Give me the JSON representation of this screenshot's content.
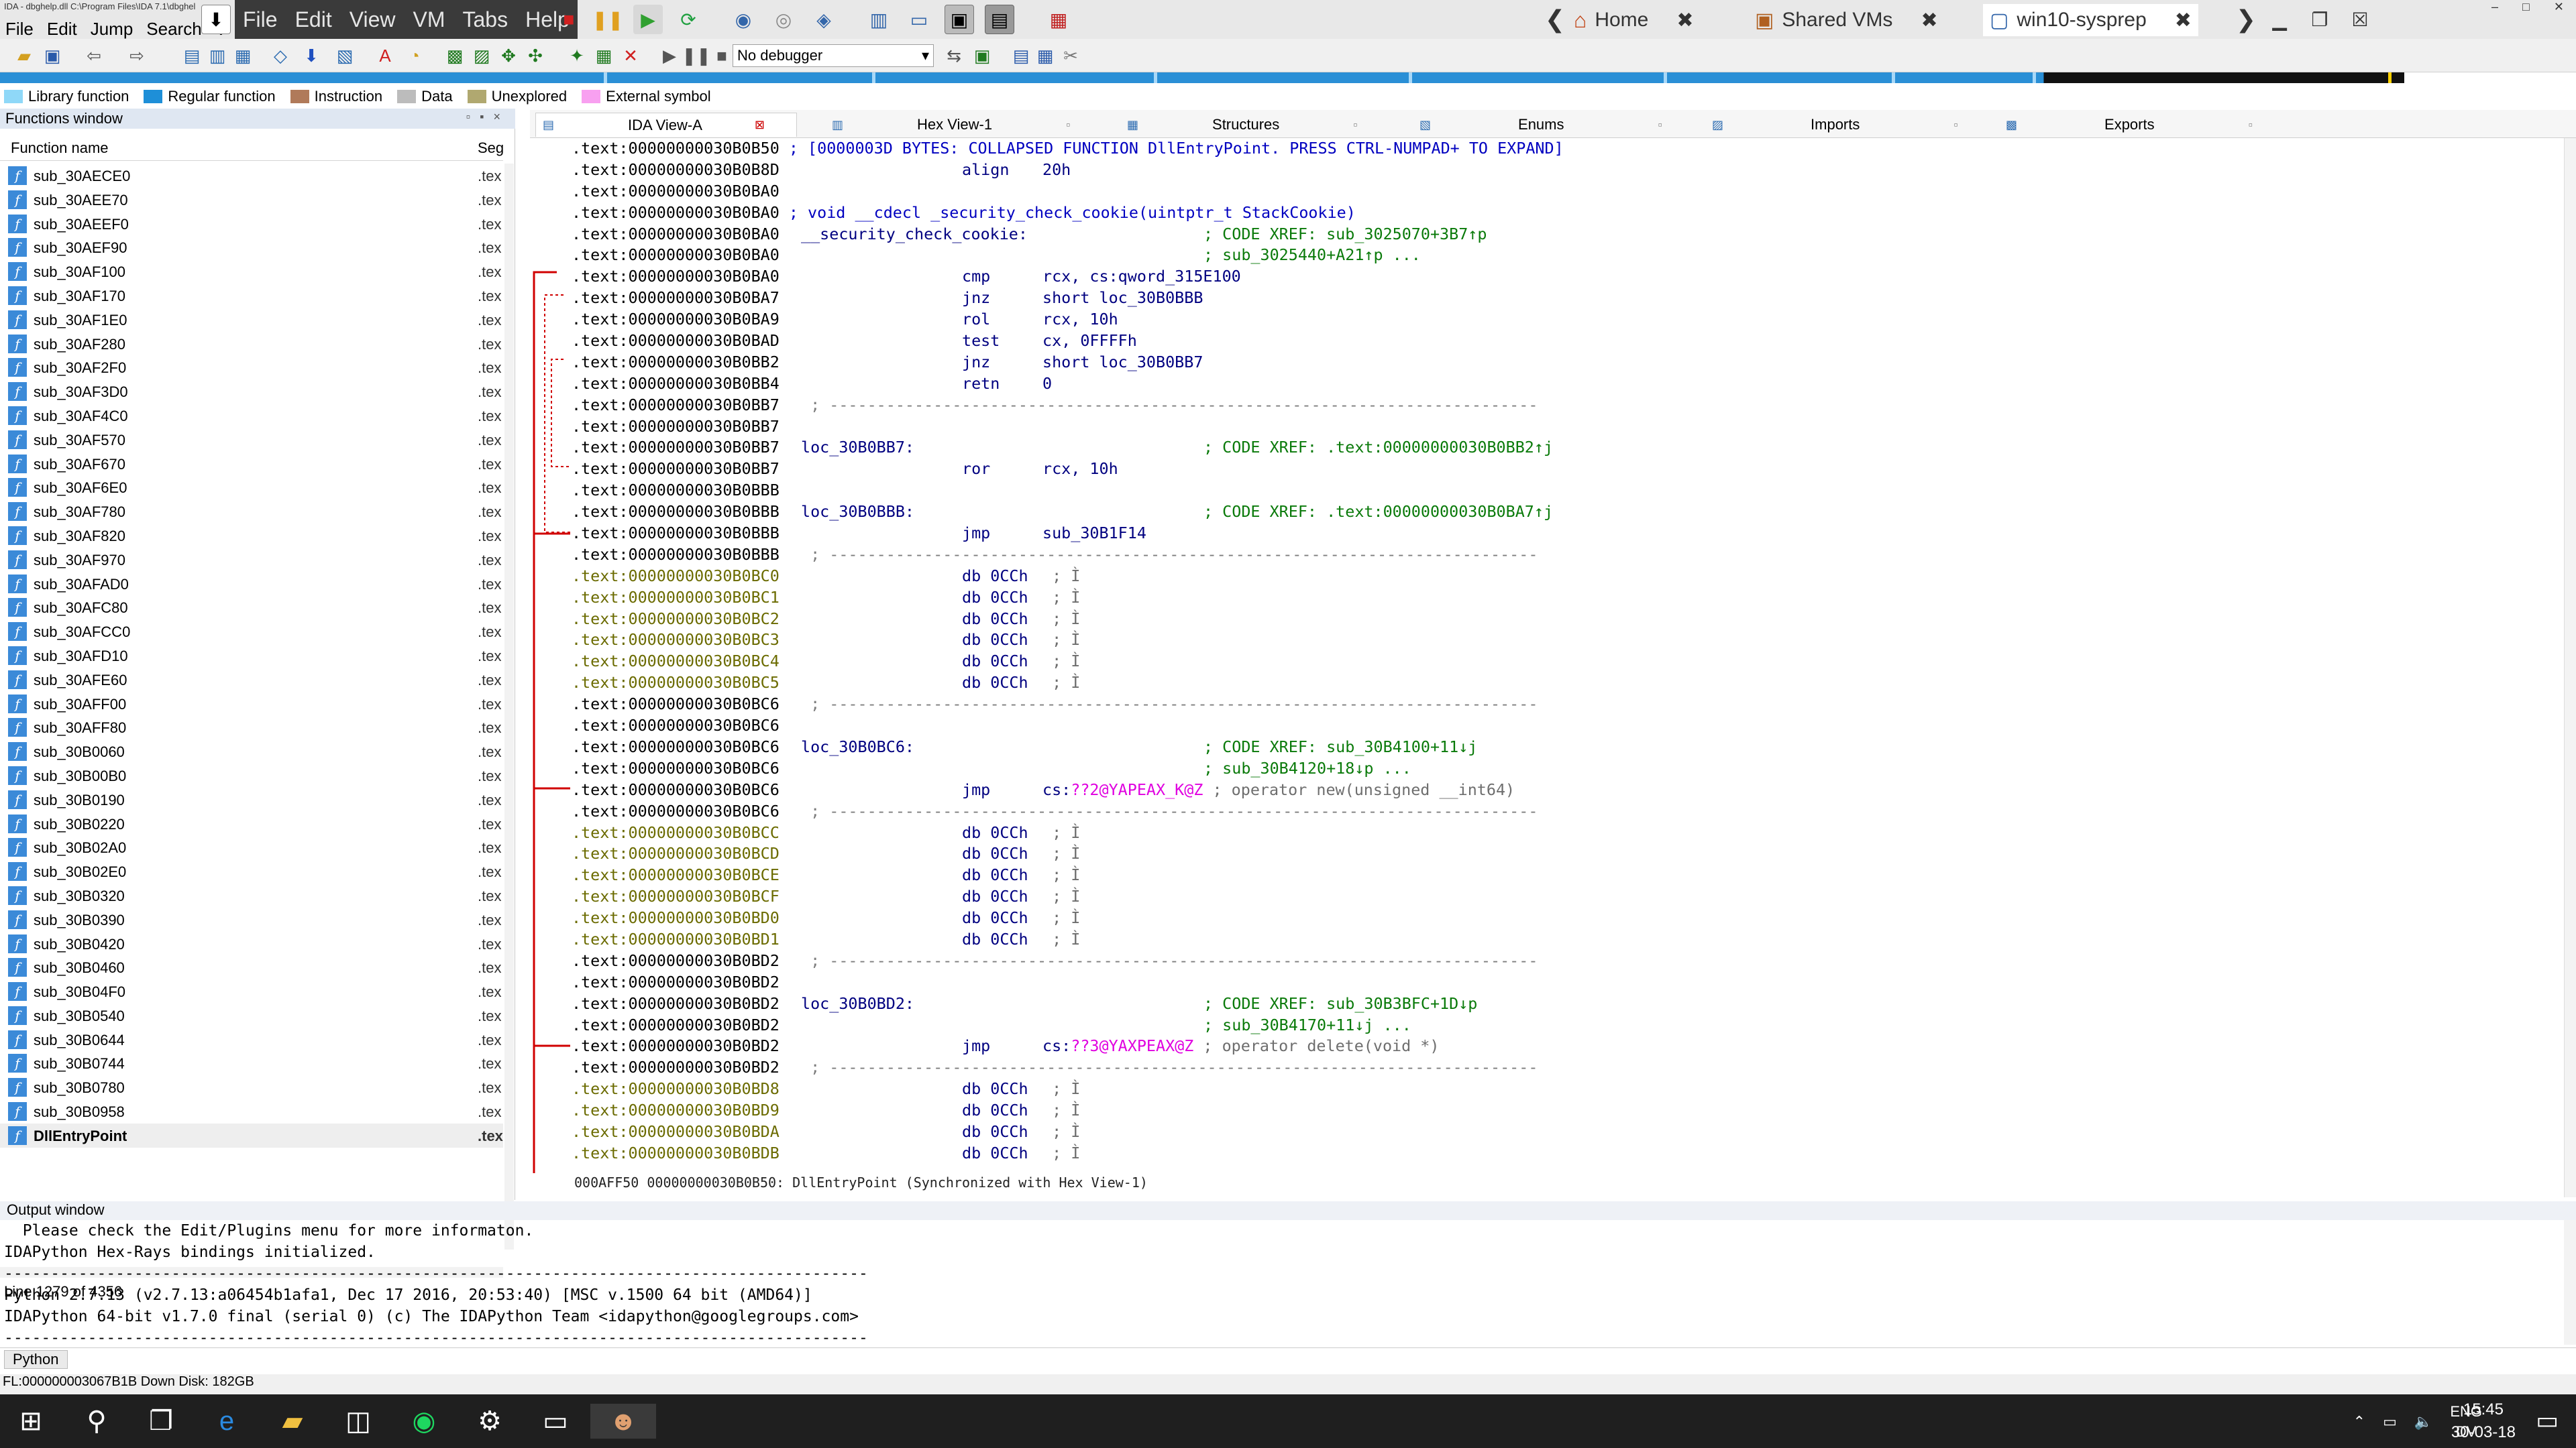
{
  "ida": {
    "title_text": "IDA - dbghelp.dll C:\\Program Files\\IDA 7.1\\dbghel",
    "menu": [
      "File",
      "Edit",
      "Jump",
      "Search",
      "V"
    ]
  },
  "vm": {
    "menu": [
      "File",
      "Edit",
      "View",
      "VM",
      "Tabs",
      "Help"
    ],
    "tabs": [
      {
        "label": "Home",
        "close": "✖"
      },
      {
        "label": "Shared VMs",
        "close": "✖"
      },
      {
        "label": "win10-sysprep",
        "close": "✖"
      }
    ]
  },
  "toolbar": {
    "debugger": "No debugger"
  },
  "legend": [
    {
      "label": "Library function",
      "color": "#8fd8f8"
    },
    {
      "label": "Regular function",
      "color": "#1e8fd8"
    },
    {
      "label": "Instruction",
      "color": "#b07a5a"
    },
    {
      "label": "Data",
      "color": "#bcbcbc"
    },
    {
      "label": "Unexplored",
      "color": "#b0a870"
    },
    {
      "label": "External symbol",
      "color": "#f8a0f0"
    }
  ],
  "functions_window": {
    "title": "Functions window",
    "col_name": "Function name",
    "col_seg": "Seg",
    "seg_value": ".tex",
    "functions": [
      "sub_30AECE0",
      "sub_30AEE70",
      "sub_30AEEF0",
      "sub_30AEF90",
      "sub_30AF100",
      "sub_30AF170",
      "sub_30AF1E0",
      "sub_30AF280",
      "sub_30AF2F0",
      "sub_30AF3D0",
      "sub_30AF4C0",
      "sub_30AF570",
      "sub_30AF670",
      "sub_30AF6E0",
      "sub_30AF780",
      "sub_30AF820",
      "sub_30AF970",
      "sub_30AFAD0",
      "sub_30AFC80",
      "sub_30AFCC0",
      "sub_30AFD10",
      "sub_30AFE60",
      "sub_30AFF00",
      "sub_30AFF80",
      "sub_30B0060",
      "sub_30B00B0",
      "sub_30B0190",
      "sub_30B0220",
      "sub_30B02A0",
      "sub_30B02E0",
      "sub_30B0320",
      "sub_30B0390",
      "sub_30B0420",
      "sub_30B0460",
      "sub_30B04F0",
      "sub_30B0540",
      "sub_30B0644",
      "sub_30B0744",
      "sub_30B0780",
      "sub_30B0958",
      "DllEntryPoint"
    ],
    "status": "Line 1279 of 4356"
  },
  "view_tabs": [
    "IDA View-A",
    "Hex View-1",
    "Structures",
    "Enums",
    "Imports",
    "Exports"
  ],
  "asm_status": "000AFF50 00000000030B0B50: DllEntryPoint (Synchronized with Hex View-1)",
  "asm": [
    {
      "addr": ".text:00000000030B0B50",
      "raw": " ; [0000003D BYTES: COLLAPSED FUNCTION DllEntryPoint. PRESS CTRL-NUMPAD+ TO EXPAND]",
      "kind": "collapsed"
    },
    {
      "addr": ".text:00000000030B0B8D",
      "mn": "align",
      "op": "20h",
      "kind": "gray"
    },
    {
      "addr": ".text:00000000030B0BA0"
    },
    {
      "addr": ".text:00000000030B0BA0",
      "raw": " ; void __cdecl _security_check_cookie(uintptr_t StackCookie)",
      "kind": "collapsed"
    },
    {
      "addr": ".text:00000000030B0BA0",
      "lbl": "__security_check_cookie:",
      "cm": "; CODE XREF: sub_3025070+3B7↑p"
    },
    {
      "addr": ".text:00000000030B0BA0",
      "cm": "; sub_3025440+A21↑p ..."
    },
    {
      "addr": ".text:00000000030B0BA0",
      "mn": "cmp",
      "op": "rcx, cs:qword_315E100"
    },
    {
      "addr": ".text:00000000030B0BA7",
      "mn": "jnz",
      "op": "short loc_30B0BBB"
    },
    {
      "addr": ".text:00000000030B0BA9",
      "mn": "rol",
      "op": "rcx, 10h"
    },
    {
      "addr": ".text:00000000030B0BAD",
      "mn": "test",
      "op": "cx, 0FFFFh"
    },
    {
      "addr": ".text:00000000030B0BB2",
      "mn": "jnz",
      "op": "short loc_30B0BB7"
    },
    {
      "addr": ".text:00000000030B0BB4",
      "mn": "retn",
      "op": "0"
    },
    {
      "addr": ".text:00000000030B0BB7",
      "sep": " ; ---------------------------------------------------------------------------"
    },
    {
      "addr": ".text:00000000030B0BB7"
    },
    {
      "addr": ".text:00000000030B0BB7",
      "lbl": "loc_30B0BB7:",
      "cm": "; CODE XREF: .text:00000000030B0BB2↑j"
    },
    {
      "addr": ".text:00000000030B0BB7",
      "mn": "ror",
      "op": "rcx, 10h"
    },
    {
      "addr": ".text:00000000030B0BBB"
    },
    {
      "addr": ".text:00000000030B0BBB",
      "lbl": "loc_30B0BBB:",
      "cm": "; CODE XREF: .text:00000000030B0BA7↑j"
    },
    {
      "addr": ".text:00000000030B0BBB",
      "mn": "jmp",
      "op": "sub_30B1F14"
    },
    {
      "addr": ".text:00000000030B0BBB",
      "sep": " ; ---------------------------------------------------------------------------"
    },
    {
      "addr": ".text:00000000030B0BC0",
      "mn": "db 0CCh",
      "op2": " ; Ì",
      "kind": "db"
    },
    {
      "addr": ".text:00000000030B0BC1",
      "mn": "db 0CCh",
      "op2": " ; Ì",
      "kind": "db"
    },
    {
      "addr": ".text:00000000030B0BC2",
      "mn": "db 0CCh",
      "op2": " ; Ì",
      "kind": "db"
    },
    {
      "addr": ".text:00000000030B0BC3",
      "mn": "db 0CCh",
      "op2": " ; Ì",
      "kind": "db"
    },
    {
      "addr": ".text:00000000030B0BC4",
      "mn": "db 0CCh",
      "op2": " ; Ì",
      "kind": "db"
    },
    {
      "addr": ".text:00000000030B0BC5",
      "mn": "db 0CCh",
      "op2": " ; Ì",
      "kind": "db"
    },
    {
      "addr": ".text:00000000030B0BC6",
      "sep": " ; ---------------------------------------------------------------------------"
    },
    {
      "addr": ".text:00000000030B0BC6"
    },
    {
      "addr": ".text:00000000030B0BC6",
      "lbl": "loc_30B0BC6:",
      "cm": "; CODE XREF: sub_30B4100+11↓j"
    },
    {
      "addr": ".text:00000000030B0BC6",
      "cm": "; sub_30B4120+18↓p ..."
    },
    {
      "addr": ".text:00000000030B0BC6",
      "mn": "jmp",
      "op": "cs:",
      "mg": "??2@YAPEAX_K@Z",
      "gc": " ; operator new(unsigned __int64)"
    },
    {
      "addr": ".text:00000000030B0BC6",
      "sep": " ; ---------------------------------------------------------------------------"
    },
    {
      "addr": ".text:00000000030B0BCC",
      "mn": "db 0CCh",
      "op2": " ; Ì",
      "kind": "db"
    },
    {
      "addr": ".text:00000000030B0BCD",
      "mn": "db 0CCh",
      "op2": " ; Ì",
      "kind": "db"
    },
    {
      "addr": ".text:00000000030B0BCE",
      "mn": "db 0CCh",
      "op2": " ; Ì",
      "kind": "db"
    },
    {
      "addr": ".text:00000000030B0BCF",
      "mn": "db 0CCh",
      "op2": " ; Ì",
      "kind": "db"
    },
    {
      "addr": ".text:00000000030B0BD0",
      "mn": "db 0CCh",
      "op2": " ; Ì",
      "kind": "db"
    },
    {
      "addr": ".text:00000000030B0BD1",
      "mn": "db 0CCh",
      "op2": " ; Ì",
      "kind": "db"
    },
    {
      "addr": ".text:00000000030B0BD2",
      "sep": " ; ---------------------------------------------------------------------------"
    },
    {
      "addr": ".text:00000000030B0BD2"
    },
    {
      "addr": ".text:00000000030B0BD2",
      "lbl": "loc_30B0BD2:",
      "cm": "; CODE XREF: sub_30B3BFC+1D↓p"
    },
    {
      "addr": ".text:00000000030B0BD2",
      "cm": "; sub_30B4170+11↓j ..."
    },
    {
      "addr": ".text:00000000030B0BD2",
      "mn": "jmp",
      "op": "cs:",
      "mg": "??3@YAXPEAX@Z",
      "gc": " ; operator delete(void *)"
    },
    {
      "addr": ".text:00000000030B0BD2",
      "sep": " ; ---------------------------------------------------------------------------"
    },
    {
      "addr": ".text:00000000030B0BD8",
      "mn": "db 0CCh",
      "op2": " ; Ì",
      "kind": "db"
    },
    {
      "addr": ".text:00000000030B0BD9",
      "mn": "db 0CCh",
      "op2": " ; Ì",
      "kind": "db"
    },
    {
      "addr": ".text:00000000030B0BDA",
      "mn": "db 0CCh",
      "op2": " ; Ì",
      "kind": "db"
    },
    {
      "addr": ".text:00000000030B0BDB",
      "mn": "db 0CCh",
      "op2": " ; Ì",
      "kind": "db"
    }
  ],
  "output": {
    "title": "Output window",
    "lines": [
      "  Please check the Edit/Plugins menu for more informaton.",
      "IDAPython Hex-Rays bindings initialized.",
      "---------------------------------------------------------------------------------------------",
      "Python 2.7.13 (v2.7.13:a06454b1afa1, Dec 17 2016, 20:53:40) [MSC v.1500 64 bit (AMD64)]",
      "IDAPython 64-bit v1.7.0 final (serial 0) (c) The IDAPython Team <idapython@googlegroups.com>",
      "---------------------------------------------------------------------------------------------"
    ],
    "python_tab": "Python"
  },
  "ida_status": "FL:000000003067B1B Down   Disk: 182GB",
  "taskbar": {
    "lang": "ENG",
    "layout": "DV",
    "time": "15:45",
    "date": "30-03-18"
  }
}
